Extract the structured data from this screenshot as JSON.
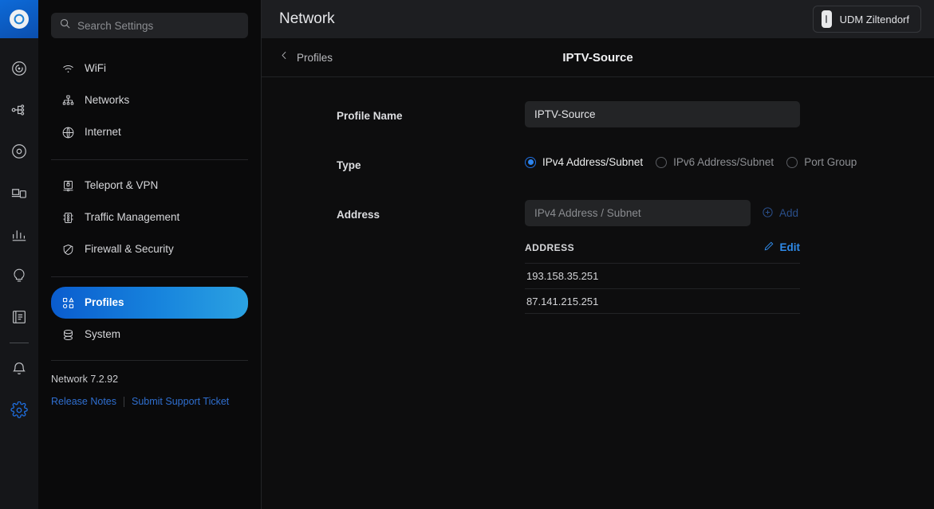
{
  "rail": {
    "logo_icon": "unifi-logo-icon",
    "items": [
      {
        "icon": "dashboard-icon",
        "name": "rail-item-dashboard",
        "active": false
      },
      {
        "icon": "topology-icon",
        "name": "rail-item-topology",
        "active": false
      },
      {
        "icon": "devices-icon",
        "name": "rail-item-devices",
        "active": false
      },
      {
        "icon": "client-devices-icon",
        "name": "rail-item-clients",
        "active": false
      },
      {
        "icon": "statistics-icon",
        "name": "rail-item-statistics",
        "active": false
      },
      {
        "icon": "insights-icon",
        "name": "rail-item-insights",
        "active": false
      },
      {
        "icon": "logs-icon",
        "name": "rail-item-logs",
        "active": false
      },
      {
        "icon": "notifications-bell-icon",
        "name": "rail-item-notifications",
        "active": false
      },
      {
        "icon": "gear-icon",
        "name": "rail-item-settings",
        "active": true
      }
    ]
  },
  "topbar": {
    "title": "Network",
    "device": {
      "label": "UDM Ziltendorf",
      "icon": "udm-device-icon"
    }
  },
  "sidebar": {
    "search": {
      "placeholder": "Search Settings",
      "value": "",
      "icon": "search-icon"
    },
    "group1": [
      {
        "label": "WiFi",
        "icon": "wifi-icon",
        "name": "sidebar-item-wifi"
      },
      {
        "label": "Networks",
        "icon": "networks-icon",
        "name": "sidebar-item-networks"
      },
      {
        "label": "Internet",
        "icon": "internet-globe-icon",
        "name": "sidebar-item-internet"
      }
    ],
    "group2": [
      {
        "label": "Teleport & VPN",
        "icon": "teleport-vpn-icon",
        "name": "sidebar-item-teleport-vpn"
      },
      {
        "label": "Traffic Management",
        "icon": "traffic-management-icon",
        "name": "sidebar-item-traffic-management"
      },
      {
        "label": "Firewall & Security",
        "icon": "shield-icon",
        "name": "sidebar-item-firewall-security"
      }
    ],
    "group3": [
      {
        "label": "Profiles",
        "icon": "profiles-icon",
        "name": "sidebar-item-profiles",
        "active": true
      },
      {
        "label": "System",
        "icon": "system-icon",
        "name": "sidebar-item-system",
        "active": false
      }
    ],
    "version": "Network 7.2.92",
    "links": {
      "release_notes": "Release Notes",
      "support_ticket": "Submit Support Ticket"
    }
  },
  "content": {
    "breadcrumb": {
      "label": "Profiles",
      "icon": "chevron-left-icon"
    },
    "page_title": "IPTV-Source",
    "fields": {
      "profile_name": {
        "label": "Profile Name",
        "value": "IPTV-Source"
      },
      "type": {
        "label": "Type",
        "options": [
          {
            "label": "IPv4 Address/Subnet",
            "selected": true
          },
          {
            "label": "IPv6 Address/Subnet",
            "selected": false
          },
          {
            "label": "Port Group",
            "selected": false
          }
        ]
      },
      "address": {
        "label": "Address",
        "placeholder": "IPv4 Address / Subnet",
        "value": "",
        "add_label": "Add",
        "add_icon": "plus-circle-icon",
        "edit_label": "Edit",
        "edit_icon": "pencil-icon",
        "column_header": "ADDRESS",
        "rows": [
          "193.158.35.251",
          "87.141.215.251"
        ]
      }
    }
  },
  "colors": {
    "accent_blue": "#2f8ae8",
    "active_gradient_start": "#0a5cce",
    "active_gradient_end": "#2ba2e2",
    "link_blue": "#2f6fd0",
    "disabled_blue": "#2a4f8a"
  }
}
